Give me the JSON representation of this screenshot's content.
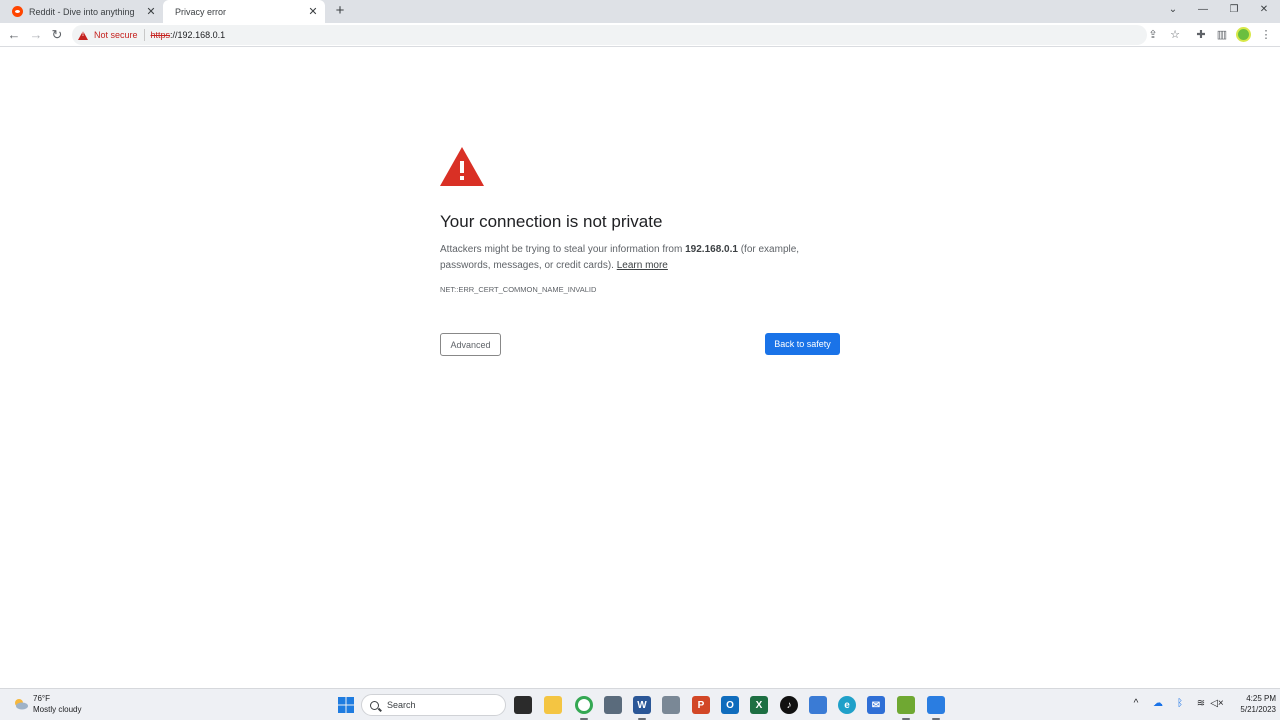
{
  "browser": {
    "tabs": [
      {
        "title": "Reddit - Dive into anything",
        "active": false
      },
      {
        "title": "Privacy error",
        "active": true
      }
    ],
    "address": {
      "security_label": "Not secure",
      "scheme": "https",
      "rest": "://192.168.0.1"
    }
  },
  "page": {
    "heading": "Your connection is not private",
    "body_before": "Attackers might be trying to steal your information from ",
    "host_bold": "192.168.0.1",
    "body_after": " (for example, passwords, messages, or credit cards). ",
    "learn_more": "Learn more",
    "error_code": "NET::ERR_CERT_COMMON_NAME_INVALID",
    "advanced_label": "Advanced",
    "back_label": "Back to safety",
    "accent_color": "#1a73e8",
    "warning_color": "#d93025"
  },
  "taskbar": {
    "weather_temp": "76°F",
    "weather_desc": "Mostly cloudy",
    "search_label": "Search",
    "time": "4:25 PM",
    "date": "5/21/2023"
  }
}
